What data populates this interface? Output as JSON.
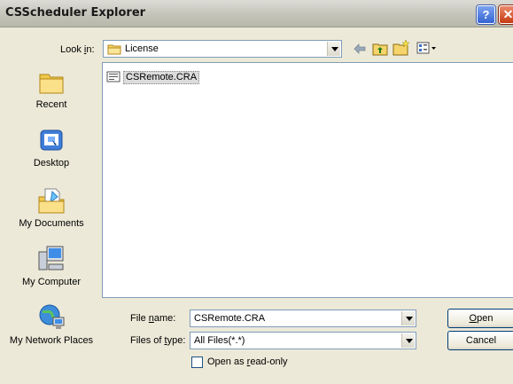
{
  "window": {
    "title": "CSScheduler Explorer",
    "help_glyph": "?",
    "close_glyph": "✕"
  },
  "lookin": {
    "label_pre": "Look ",
    "label_key": "i",
    "label_post": "n:",
    "value": "License"
  },
  "places": [
    {
      "label": "Recent",
      "icon": "recent-folder-icon"
    },
    {
      "label": "Desktop",
      "icon": "desktop-icon"
    },
    {
      "label": "My Documents",
      "icon": "my-documents-icon"
    },
    {
      "label": "My Computer",
      "icon": "my-computer-icon"
    },
    {
      "label": "My Network Places",
      "icon": "network-places-icon"
    }
  ],
  "files": [
    {
      "name": "CSRemote.CRA"
    }
  ],
  "filename": {
    "label_pre": "File ",
    "label_key": "n",
    "label_post": "ame:",
    "value": "CSRemote.CRA"
  },
  "filetype": {
    "label_pre": "Files of ",
    "label_key": "t",
    "label_post": "ype:",
    "value": "All Files(*.*)"
  },
  "readonly": {
    "label_pre": "Open as ",
    "label_key": "r",
    "label_post": "ead-only"
  },
  "buttons": {
    "open_key": "O",
    "open_rest": "pen",
    "cancel": "Cancel"
  }
}
